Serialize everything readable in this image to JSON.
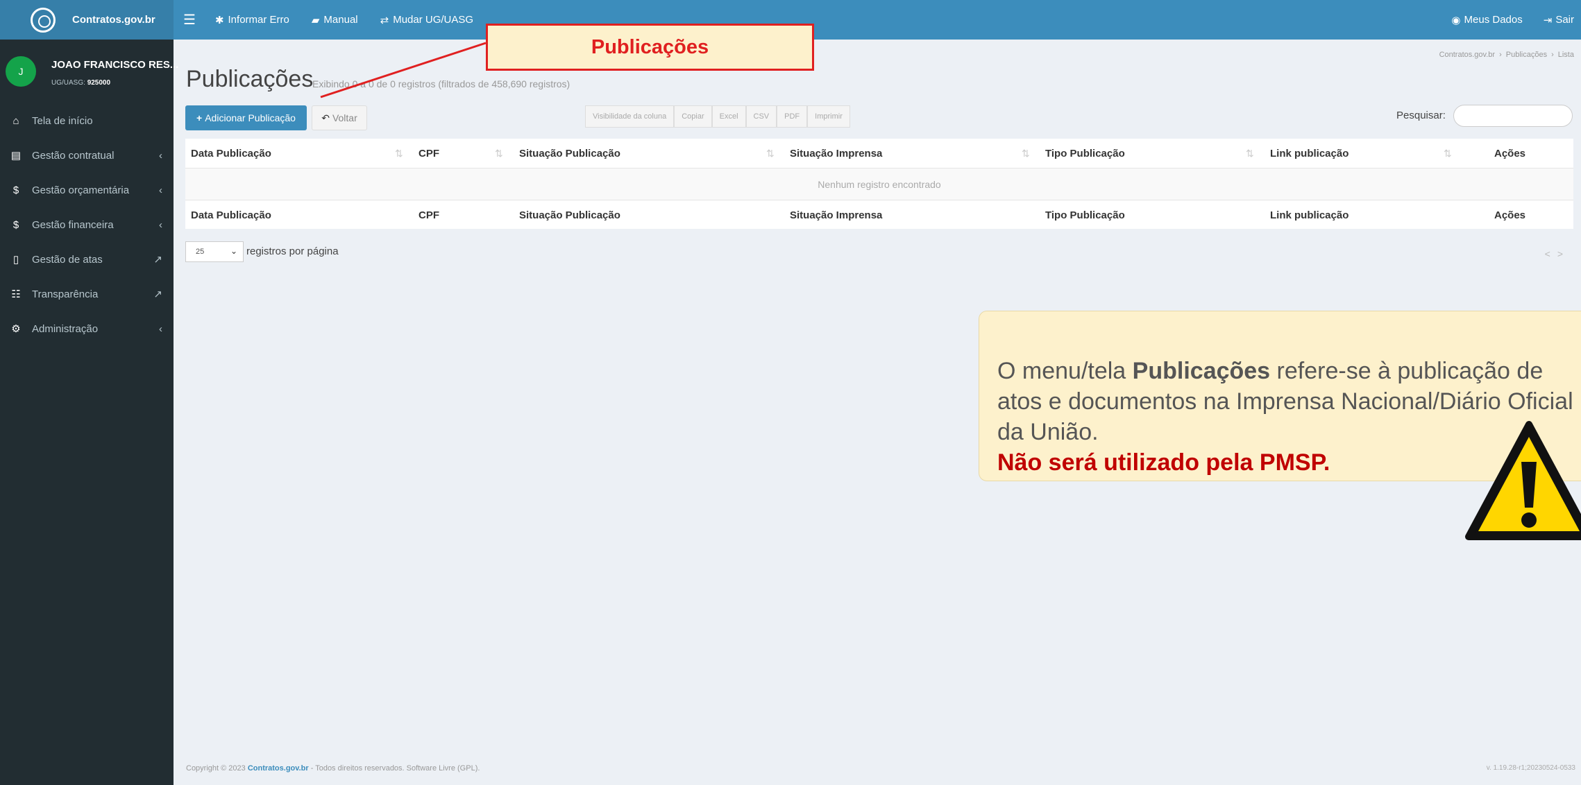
{
  "brand": {
    "name": "Contratos.gov.br"
  },
  "topnav": {
    "menu_icon": "bars-icon",
    "items": [
      {
        "label": "Informar Erro",
        "icon": "bug-icon"
      },
      {
        "label": "Manual",
        "icon": "book-icon"
      },
      {
        "label": "Mudar UG/UASG",
        "icon": "exchange-icon"
      }
    ],
    "right": [
      {
        "label": "Meus Dados",
        "icon": "user-circle-icon"
      },
      {
        "label": "Sair",
        "icon": "sign-out-icon"
      }
    ]
  },
  "user": {
    "initial": "J",
    "name": "JOAO FRANCISCO RES...",
    "unit_label": "UG/UASG:",
    "unit_code": "925000"
  },
  "sidebar": {
    "items": [
      {
        "label": "Tela de início",
        "icon": "home-icon",
        "right": ""
      },
      {
        "label": "Gestão contratual",
        "icon": "file-text-icon",
        "right": "‹"
      },
      {
        "label": "Gestão orçamentária",
        "icon": "dollar-icon",
        "right": "‹"
      },
      {
        "label": "Gestão financeira",
        "icon": "dollar-icon",
        "right": "‹"
      },
      {
        "label": "Gestão de atas",
        "icon": "file-icon",
        "right": "↗"
      },
      {
        "label": "Transparência",
        "icon": "list-icon",
        "right": "↗"
      },
      {
        "label": "Administração",
        "icon": "cogs-icon",
        "right": "‹"
      }
    ]
  },
  "page": {
    "title": "Publicações",
    "subtitle": "Exibindo 0 a 0 de 0 registros (filtrados de 458,690 registros)",
    "breadcrumb": [
      "Contratos.gov.br",
      "Publicações",
      "Lista"
    ]
  },
  "toolbar": {
    "add_label": "Adicionar Publicação",
    "back_label": "Voltar",
    "export_buttons": [
      "Visibilidade da coluna",
      "Copiar",
      "Excel",
      "CSV",
      "PDF",
      "Imprimir"
    ],
    "search_label": "Pesquisar:",
    "search_value": ""
  },
  "table": {
    "columns": [
      "Data Publicação",
      "CPF",
      "Situação Publicação",
      "Situação Imprensa",
      "Tipo Publicação",
      "Link publicação",
      "Ações"
    ],
    "empty_message": "Nenhum registro encontrado"
  },
  "pager": {
    "page_size": "25",
    "label": "registros por página",
    "prev": "<",
    "next": ">"
  },
  "footer": {
    "copyright_prefix": "Copyright © 2023",
    "copyright_brand": "Contratos.gov.br",
    "copyright_suffix": "- Todos direitos reservados. Software Livre (GPL).",
    "version": "v. 1.19.28-r1;20230524-0533"
  },
  "annotation": {
    "title": "Publicações",
    "text_prefix": "O menu/tela",
    "text_bold": "Publicações",
    "text_rest": "refere-se à publicação de atos e documentos na Imprensa Nacional/Diário Oficial da União.",
    "warning": "Não será utilizado pela PMSP.",
    "warning_icon": "warning-triangle-icon",
    "accent_color": "#e02020"
  }
}
